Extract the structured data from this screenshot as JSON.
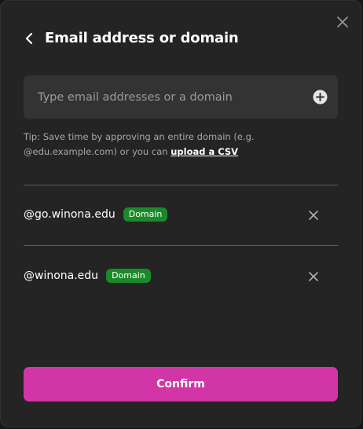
{
  "header": {
    "title": "Email address or domain"
  },
  "input": {
    "placeholder": "Type email addresses or a domain",
    "value": ""
  },
  "tip": {
    "text": "Tip: Save time by approving an entire domain (e.g. @edu.example.com) or you can ",
    "link_label": "upload a CSV"
  },
  "domains": [
    {
      "address": "@go.winona.edu",
      "badge": "Domain"
    },
    {
      "address": "@winona.edu",
      "badge": "Domain"
    }
  ],
  "confirm_label": "Confirm",
  "colors": {
    "accent": "#d135a6",
    "badge": "#1a8a28",
    "background": "#242424",
    "input_background": "#333333"
  },
  "icons": {
    "close": "close-icon",
    "back": "chevron-left-icon",
    "add": "plus-circle-icon",
    "remove": "x-icon"
  }
}
